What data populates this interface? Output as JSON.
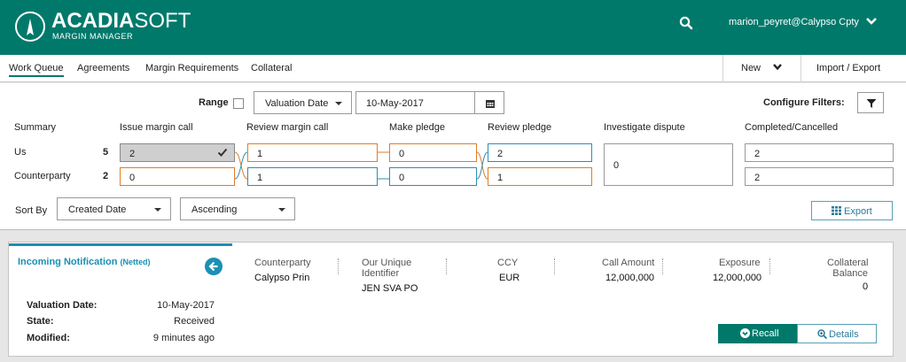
{
  "header": {
    "brand_bold": "ACADIA",
    "brand_light": "SOFT",
    "brand_sub": "MARGIN MANAGER",
    "user": "marion_peyret@Calypso Cpty",
    "accent": "#00796b"
  },
  "nav": {
    "items": [
      {
        "label": "Work Queue",
        "active": true
      },
      {
        "label": "Agreements"
      },
      {
        "label": "Margin Requirements"
      },
      {
        "label": "Collateral"
      }
    ],
    "new_label": "New",
    "import_export_label": "Import / Export"
  },
  "filters": {
    "range_label": "Range",
    "date_type": "Valuation Date",
    "date_value": "10-May-2017",
    "configure_label": "Configure Filters:"
  },
  "summary": {
    "label": "Summary",
    "columns": [
      "Issue margin call",
      "Review margin call",
      "Make pledge",
      "Review pledge",
      "Investigate dispute",
      "Completed/Cancelled"
    ],
    "rows": [
      {
        "label": "Us",
        "count": "5",
        "values": [
          "2",
          "1",
          "0",
          "2"
        ],
        "completed": "2"
      },
      {
        "label": "Counterparty",
        "count": "2",
        "values": [
          "0",
          "1",
          "0",
          "1"
        ],
        "completed": "2"
      }
    ],
    "dispute_value": "0"
  },
  "sort": {
    "label": "Sort By",
    "field": "Created Date",
    "order": "Ascending",
    "export_label": "Export"
  },
  "card": {
    "title": "Incoming Notification",
    "title_tag": "(Netted)",
    "fields": [
      {
        "label": "Valuation Date:",
        "value": "10-May-2017"
      },
      {
        "label": "State:",
        "value": "Received"
      },
      {
        "label": "Modified:",
        "value": "9 minutes ago"
      }
    ],
    "columns": {
      "counterparty": {
        "header": "Counterparty",
        "value": "Calypso Prin"
      },
      "unique_id": {
        "header1": "Our Unique",
        "header2": "Identifier",
        "value": "JEN SVA PO"
      },
      "ccy": {
        "header": "CCY",
        "value": "EUR"
      },
      "call_amount": {
        "header": "Call Amount",
        "value": "12,000,000"
      },
      "exposure": {
        "header": "Exposure",
        "value": "12,000,000"
      },
      "collateral_balance": {
        "header1": "Collateral",
        "header2": "Balance",
        "value": "0"
      }
    },
    "recall_label": "Recall",
    "details_label": "Details"
  }
}
